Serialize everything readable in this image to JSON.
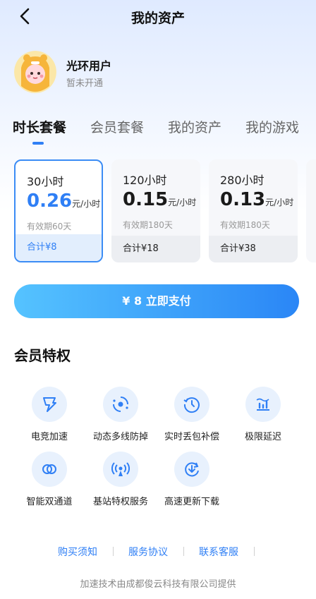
{
  "nav": {
    "title": "我的资产"
  },
  "profile": {
    "name": "光环用户",
    "status": "暂未开通"
  },
  "tabs": [
    {
      "label": "时长套餐",
      "active": true
    },
    {
      "label": "会员套餐",
      "active": false
    },
    {
      "label": "我的资产",
      "active": false
    },
    {
      "label": "我的游戏",
      "active": false
    }
  ],
  "plans": [
    {
      "name": "30小时",
      "price": "0.26",
      "unit": "元/小时",
      "validity": "有效期60天",
      "total": "合计¥8",
      "selected": true
    },
    {
      "name": "120小时",
      "price": "0.15",
      "unit": "元/小时",
      "validity": "有效期180天",
      "total": "合计¥18",
      "selected": false
    },
    {
      "name": "280小时",
      "price": "0.13",
      "unit": "元/小时",
      "validity": "有效期180天",
      "total": "合计¥38",
      "selected": false
    }
  ],
  "pay_button": {
    "label": "¥ 8 立即支付"
  },
  "privileges": {
    "title": "会员特权",
    "items": [
      {
        "label": "电竞加速",
        "icon": "lightning-icon"
      },
      {
        "label": "动态多线防掉",
        "icon": "multiline-icon"
      },
      {
        "label": "实时丢包补偿",
        "icon": "history-clock-icon"
      },
      {
        "label": "极限延迟",
        "icon": "latency-chart-icon"
      },
      {
        "label": "智能双通道",
        "icon": "dual-channel-icon"
      },
      {
        "label": "基站特权服务",
        "icon": "broadcast-icon"
      },
      {
        "label": "高速更新下载",
        "icon": "download-refresh-icon"
      }
    ]
  },
  "footer": {
    "links": [
      "购买须知",
      "服务协议",
      "联系客服"
    ],
    "provider": "加速技术由成都俊云科技有限公司提供"
  },
  "colors": {
    "accent": "#2f7ff5",
    "gradient_start": "#55c3ff",
    "gradient_end": "#2a86f6"
  }
}
